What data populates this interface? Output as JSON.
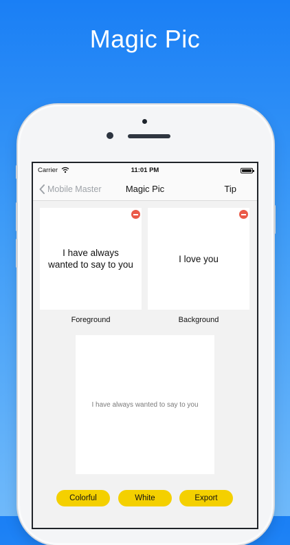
{
  "headline": "Magic Pic",
  "status_bar": {
    "carrier": "Carrier",
    "time": "11:01 PM"
  },
  "nav": {
    "back_label": "Mobile Master",
    "title": "Magic Pic",
    "tip_label": "Tip"
  },
  "foreground": {
    "text": "I have always wanted to say to you",
    "label": "Foreground"
  },
  "background": {
    "text": "I love you",
    "label": "Background"
  },
  "preview": {
    "text": "I have always wanted to say to you"
  },
  "buttons": {
    "colorful": "Colorful",
    "white": "White",
    "export": "Export"
  },
  "colors": {
    "accent": "#F4D000",
    "remove": "#EA5A48",
    "backdrop": "#1A7FF5"
  },
  "icons": [
    "wifi-icon",
    "battery-icon",
    "chevron-left-icon",
    "remove-icon"
  ]
}
